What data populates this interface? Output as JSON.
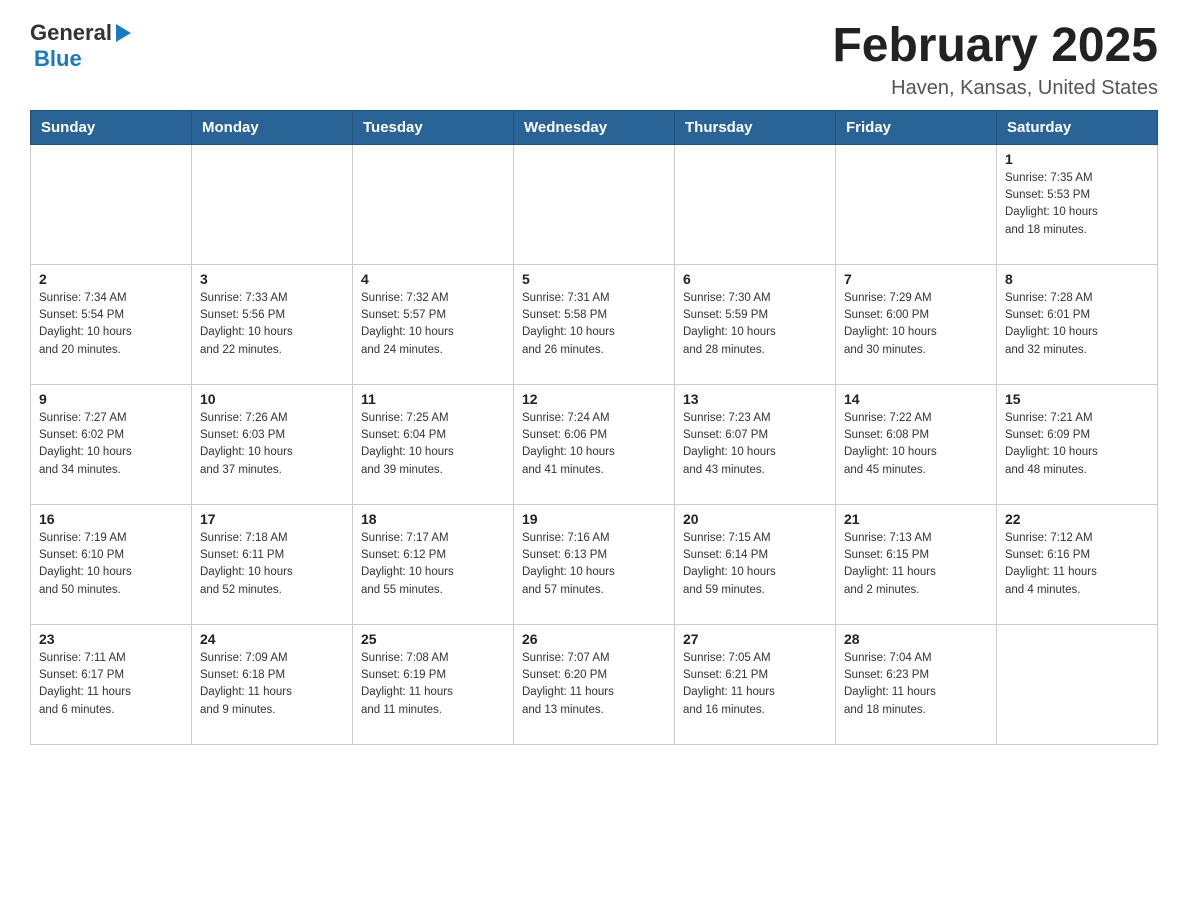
{
  "header": {
    "logo_general": "General",
    "logo_blue": "Blue",
    "title": "February 2025",
    "subtitle": "Haven, Kansas, United States"
  },
  "days_of_week": [
    "Sunday",
    "Monday",
    "Tuesday",
    "Wednesday",
    "Thursday",
    "Friday",
    "Saturday"
  ],
  "weeks": [
    {
      "days": [
        {
          "number": "",
          "info": ""
        },
        {
          "number": "",
          "info": ""
        },
        {
          "number": "",
          "info": ""
        },
        {
          "number": "",
          "info": ""
        },
        {
          "number": "",
          "info": ""
        },
        {
          "number": "",
          "info": ""
        },
        {
          "number": "1",
          "info": "Sunrise: 7:35 AM\nSunset: 5:53 PM\nDaylight: 10 hours\nand 18 minutes."
        }
      ]
    },
    {
      "days": [
        {
          "number": "2",
          "info": "Sunrise: 7:34 AM\nSunset: 5:54 PM\nDaylight: 10 hours\nand 20 minutes."
        },
        {
          "number": "3",
          "info": "Sunrise: 7:33 AM\nSunset: 5:56 PM\nDaylight: 10 hours\nand 22 minutes."
        },
        {
          "number": "4",
          "info": "Sunrise: 7:32 AM\nSunset: 5:57 PM\nDaylight: 10 hours\nand 24 minutes."
        },
        {
          "number": "5",
          "info": "Sunrise: 7:31 AM\nSunset: 5:58 PM\nDaylight: 10 hours\nand 26 minutes."
        },
        {
          "number": "6",
          "info": "Sunrise: 7:30 AM\nSunset: 5:59 PM\nDaylight: 10 hours\nand 28 minutes."
        },
        {
          "number": "7",
          "info": "Sunrise: 7:29 AM\nSunset: 6:00 PM\nDaylight: 10 hours\nand 30 minutes."
        },
        {
          "number": "8",
          "info": "Sunrise: 7:28 AM\nSunset: 6:01 PM\nDaylight: 10 hours\nand 32 minutes."
        }
      ]
    },
    {
      "days": [
        {
          "number": "9",
          "info": "Sunrise: 7:27 AM\nSunset: 6:02 PM\nDaylight: 10 hours\nand 34 minutes."
        },
        {
          "number": "10",
          "info": "Sunrise: 7:26 AM\nSunset: 6:03 PM\nDaylight: 10 hours\nand 37 minutes."
        },
        {
          "number": "11",
          "info": "Sunrise: 7:25 AM\nSunset: 6:04 PM\nDaylight: 10 hours\nand 39 minutes."
        },
        {
          "number": "12",
          "info": "Sunrise: 7:24 AM\nSunset: 6:06 PM\nDaylight: 10 hours\nand 41 minutes."
        },
        {
          "number": "13",
          "info": "Sunrise: 7:23 AM\nSunset: 6:07 PM\nDaylight: 10 hours\nand 43 minutes."
        },
        {
          "number": "14",
          "info": "Sunrise: 7:22 AM\nSunset: 6:08 PM\nDaylight: 10 hours\nand 45 minutes."
        },
        {
          "number": "15",
          "info": "Sunrise: 7:21 AM\nSunset: 6:09 PM\nDaylight: 10 hours\nand 48 minutes."
        }
      ]
    },
    {
      "days": [
        {
          "number": "16",
          "info": "Sunrise: 7:19 AM\nSunset: 6:10 PM\nDaylight: 10 hours\nand 50 minutes."
        },
        {
          "number": "17",
          "info": "Sunrise: 7:18 AM\nSunset: 6:11 PM\nDaylight: 10 hours\nand 52 minutes."
        },
        {
          "number": "18",
          "info": "Sunrise: 7:17 AM\nSunset: 6:12 PM\nDaylight: 10 hours\nand 55 minutes."
        },
        {
          "number": "19",
          "info": "Sunrise: 7:16 AM\nSunset: 6:13 PM\nDaylight: 10 hours\nand 57 minutes."
        },
        {
          "number": "20",
          "info": "Sunrise: 7:15 AM\nSunset: 6:14 PM\nDaylight: 10 hours\nand 59 minutes."
        },
        {
          "number": "21",
          "info": "Sunrise: 7:13 AM\nSunset: 6:15 PM\nDaylight: 11 hours\nand 2 minutes."
        },
        {
          "number": "22",
          "info": "Sunrise: 7:12 AM\nSunset: 6:16 PM\nDaylight: 11 hours\nand 4 minutes."
        }
      ]
    },
    {
      "days": [
        {
          "number": "23",
          "info": "Sunrise: 7:11 AM\nSunset: 6:17 PM\nDaylight: 11 hours\nand 6 minutes."
        },
        {
          "number": "24",
          "info": "Sunrise: 7:09 AM\nSunset: 6:18 PM\nDaylight: 11 hours\nand 9 minutes."
        },
        {
          "number": "25",
          "info": "Sunrise: 7:08 AM\nSunset: 6:19 PM\nDaylight: 11 hours\nand 11 minutes."
        },
        {
          "number": "26",
          "info": "Sunrise: 7:07 AM\nSunset: 6:20 PM\nDaylight: 11 hours\nand 13 minutes."
        },
        {
          "number": "27",
          "info": "Sunrise: 7:05 AM\nSunset: 6:21 PM\nDaylight: 11 hours\nand 16 minutes."
        },
        {
          "number": "28",
          "info": "Sunrise: 7:04 AM\nSunset: 6:23 PM\nDaylight: 11 hours\nand 18 minutes."
        },
        {
          "number": "",
          "info": ""
        }
      ]
    }
  ]
}
